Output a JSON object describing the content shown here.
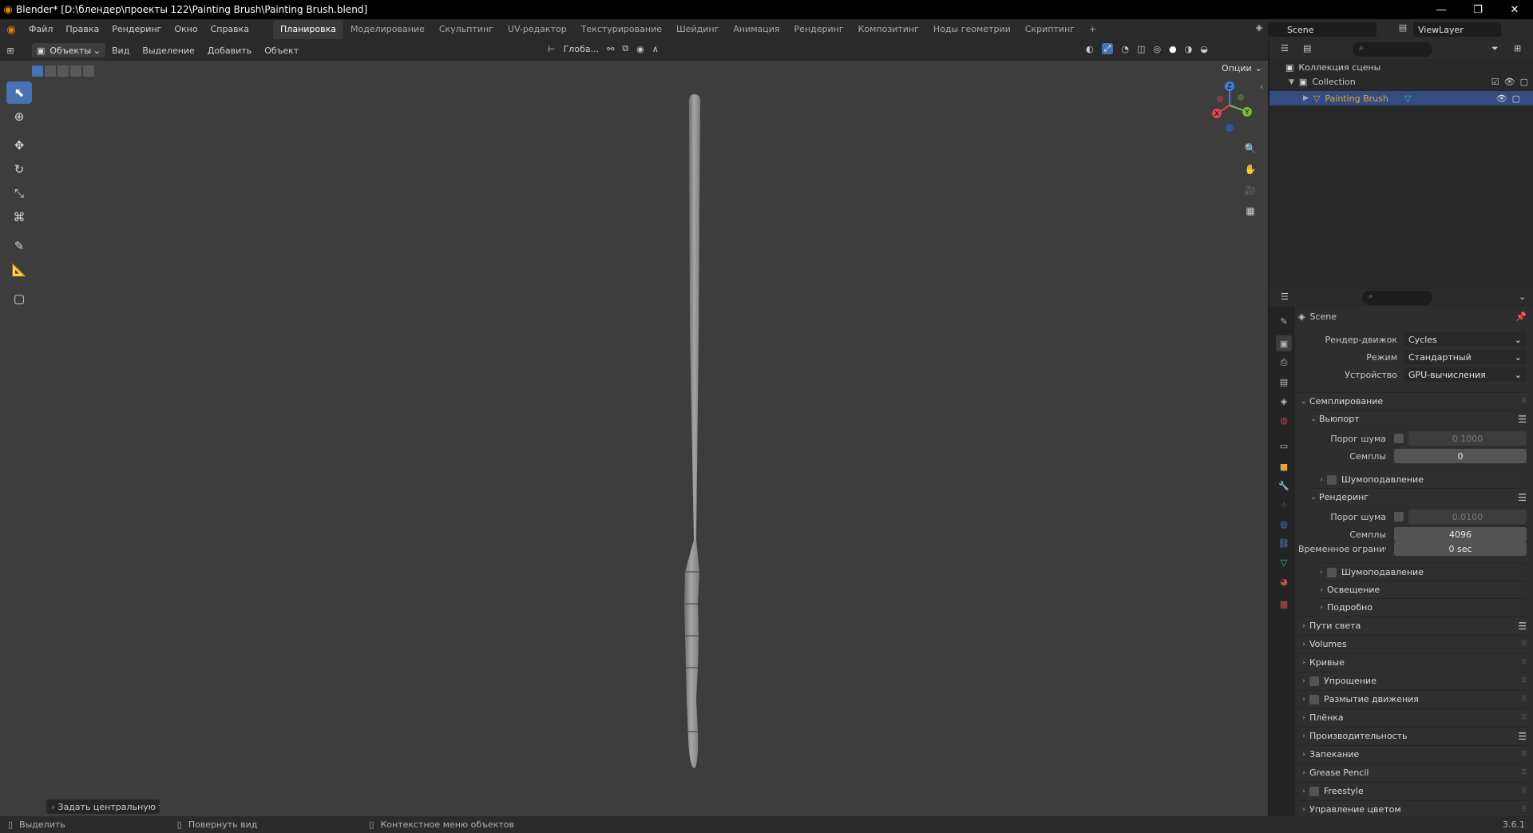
{
  "window": {
    "title": "Blender* [D:\\блендер\\проекты 122\\Painting Brush\\Painting Brush.blend]",
    "controls": [
      "minimize-icon",
      "restore-icon",
      "close-icon"
    ]
  },
  "menu": [
    "Файл",
    "Правка",
    "Рендеринг",
    "Окно",
    "Справка"
  ],
  "workspaces": [
    {
      "label": "Планировка",
      "active": true
    },
    {
      "label": "Моделирование"
    },
    {
      "label": "Скульптинг"
    },
    {
      "label": "UV-редактор"
    },
    {
      "label": "Текстурирование"
    },
    {
      "label": "Шейдинг"
    },
    {
      "label": "Анимация"
    },
    {
      "label": "Рендеринг"
    },
    {
      "label": "Композитинг"
    },
    {
      "label": "Ноды геометрии"
    },
    {
      "label": "Скриптинг"
    }
  ],
  "workspace_add": "+",
  "scene_name": "Scene",
  "view_layer": "ViewLayer",
  "viewport": {
    "mode": "Объекты",
    "menus": [
      "Вид",
      "Выделение",
      "Добавить",
      "Объект"
    ],
    "orientation": "Глоба...",
    "options": "Опции",
    "last_operator": "Задать центральную точ",
    "gizmo_axes": [
      "Z",
      "Y",
      "X"
    ]
  },
  "outliner": {
    "root": "Коллекция сцены",
    "collection": "Collection",
    "object": "Painting Brush"
  },
  "properties": {
    "context": "Scene",
    "render_engine_label": "Рендер-движок",
    "render_engine": "Cycles",
    "mode_label": "Режим",
    "mode": "Стандартный",
    "device_label": "Устройство",
    "device": "GPU-вычисления",
    "sampling": "Семплирование",
    "viewport": "Вьюпорт",
    "noise_threshold_label": "Порог шума",
    "vp_noise_threshold": "0.1000",
    "samples_label": "Семплы",
    "vp_samples": "0",
    "denoise": "Шумоподавление",
    "render": "Рендеринг",
    "r_noise_threshold": "0.0100",
    "r_samples": "4096",
    "time_limit_label": "Временное огранич...",
    "time_limit": "0 sec",
    "lights": "Освещение",
    "advanced": "Подробно",
    "sections": [
      {
        "label": "Пути света",
        "list": true
      },
      {
        "label": "Volumes"
      },
      {
        "label": "Кривые"
      },
      {
        "label": "Упрощение",
        "check": true
      },
      {
        "label": "Размытие движения",
        "check": true
      },
      {
        "label": "Плёнка"
      },
      {
        "label": "Производительность",
        "list": true
      },
      {
        "label": "Запекание"
      },
      {
        "label": "Grease Pencil"
      },
      {
        "label": "Freestyle",
        "check": true
      },
      {
        "label": "Управление цветом"
      }
    ]
  },
  "status": {
    "select": "Выделить",
    "rotate": "Повернуть вид",
    "context_menu": "Контекстное меню объектов",
    "version": "3.6.1"
  },
  "colors": {
    "accent": "#4772b3",
    "object_orange": "#e8a23c",
    "viewport_bg": "#3d3d3d"
  }
}
